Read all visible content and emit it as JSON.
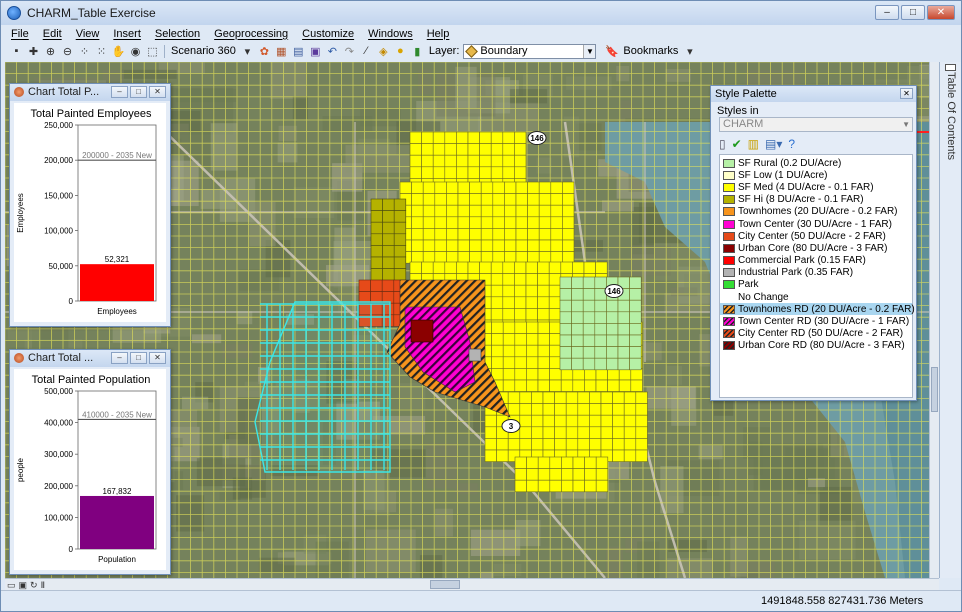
{
  "window": {
    "title": "CHARM_Table Exercise",
    "buttons": {
      "minimize": "–",
      "maximize": "□",
      "close": "✕"
    }
  },
  "menu": [
    "File",
    "Edit",
    "View",
    "Insert",
    "Selection",
    "Geoprocessing",
    "Customize",
    "Windows",
    "Help"
  ],
  "toolbar": {
    "scenario_label": "Scenario 360",
    "layer_label": "Layer:",
    "layer_value": "Boundary",
    "bookmarks_label": "Bookmarks"
  },
  "map": {
    "highway_shields": [
      "146",
      "146",
      "3"
    ]
  },
  "employees_chart": {
    "window_title": "Chart Total P...",
    "chart_data": {
      "type": "bar",
      "title": "Total Painted Employees",
      "categories": [
        "Employees"
      ],
      "values": [
        52321
      ],
      "value_label": "52,321",
      "ylabel": "Employees",
      "xlabel": "Employees",
      "ylim": [
        0,
        250000
      ],
      "yticks": [
        "0",
        "50,000",
        "100,000",
        "150,000",
        "200,000",
        "250,000"
      ],
      "target": {
        "value": 200000,
        "label": "200000 - 2035 New"
      },
      "bar_color": "#ff0000"
    }
  },
  "population_chart": {
    "window_title": "Chart Total ...",
    "chart_data": {
      "type": "bar",
      "title": "Total Painted Population",
      "categories": [
        "Population"
      ],
      "values": [
        167832
      ],
      "value_label": "167,832",
      "ylabel": "people",
      "xlabel": "Population",
      "ylim": [
        0,
        500000
      ],
      "yticks": [
        "0",
        "100,000",
        "200,000",
        "300,000",
        "400,000",
        "500,000"
      ],
      "target": {
        "value": 410000,
        "label": "410000 - 2035 New"
      },
      "bar_color": "#800080"
    }
  },
  "style_palette": {
    "title": "Style Palette",
    "styles_in_label": "Styles in",
    "styles_in_value": "CHARM",
    "items": [
      {
        "label": "SF Rural (0.2 DU/Acre)",
        "color": "#b6f0a6",
        "hatch": false
      },
      {
        "label": "SF Low (1 DU/Acre)",
        "color": "#ffffc8",
        "hatch": false
      },
      {
        "label": "SF Med (4 DU/Acre - 0.1 FAR)",
        "color": "#ffff00",
        "hatch": false
      },
      {
        "label": "SF Hi (8 DU/Acre - 0.1 FAR)",
        "color": "#b5b200",
        "hatch": false
      },
      {
        "label": "Townhomes (20 DU/Acre - 0.2 FAR)",
        "color": "#f7941d",
        "hatch": false
      },
      {
        "label": "Town Center (30 DU/Acre - 1 FAR)",
        "color": "#ff00d2",
        "hatch": false
      },
      {
        "label": "City Center (50 DU/Acre - 2 FAR)",
        "color": "#e64a19",
        "hatch": false
      },
      {
        "label": "Urban Core (80 DU/Acre - 3 FAR)",
        "color": "#8b0000",
        "hatch": false
      },
      {
        "label": "Commercial Park (0.15 FAR)",
        "color": "#ff0000",
        "hatch": false
      },
      {
        "label": "Industrial Park (0.35 FAR)",
        "color": "#b3b3b3",
        "hatch": false
      },
      {
        "label": "Park",
        "color": "#33dd33",
        "hatch": false
      },
      {
        "label": "No Change",
        "color": "",
        "hatch": false
      },
      {
        "label": "Townhomes RD (20 DU/Acre - 0.2 FAR)",
        "color": "#f7941d",
        "hatch": true,
        "selected": true
      },
      {
        "label": "Town Center RD (30 DU/Acre - 1 FAR)",
        "color": "#ff00d2",
        "hatch": true
      },
      {
        "label": "City Center RD (50 DU/Acre - 2 FAR)",
        "color": "#e64a19",
        "hatch": true
      },
      {
        "label": "Urban Core RD (80 DU/Acre - 3 FAR)",
        "color": "#8b0000",
        "hatch": true
      }
    ]
  },
  "toc_tab_label": "Table Of Contents",
  "status": {
    "coordinates": "1491848.558  827431.736 Meters"
  }
}
